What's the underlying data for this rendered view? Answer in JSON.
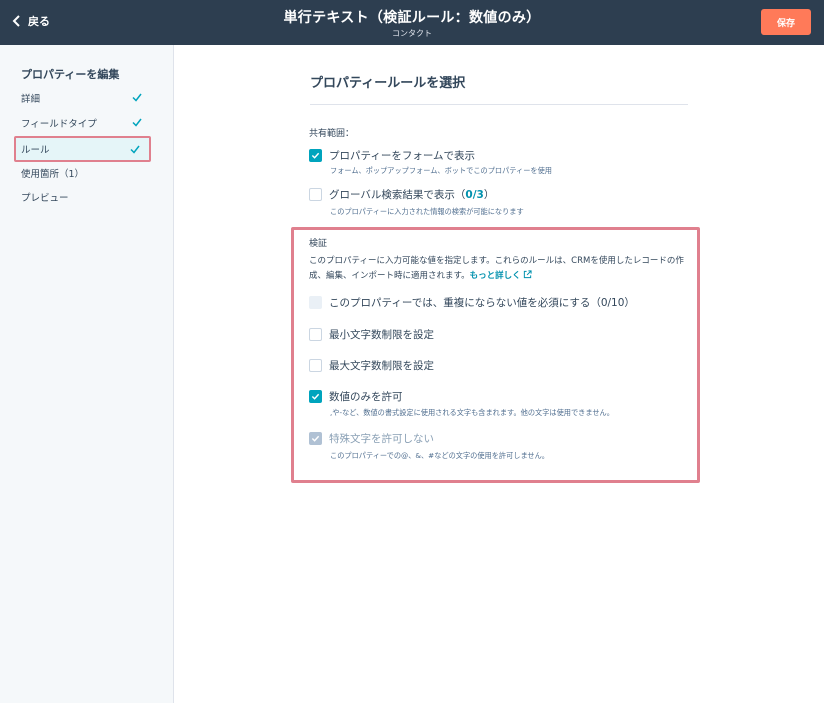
{
  "header": {
    "back_label": "戻る",
    "title": "単行テキスト（検証ルール：数値のみ）",
    "subtitle": "コンタクト",
    "save_label": "保存"
  },
  "sidebar": {
    "title": "プロパティーを編集",
    "items": [
      {
        "label": "詳細",
        "checked": true,
        "active": false
      },
      {
        "label": "フィールドタイプ",
        "checked": true,
        "active": false
      },
      {
        "label": "ルール",
        "checked": true,
        "active": true
      },
      {
        "label": "使用箇所（1）",
        "checked": false,
        "active": false
      },
      {
        "label": "プレビュー",
        "checked": false,
        "active": false
      }
    ]
  },
  "main": {
    "title": "プロパティールールを選択",
    "shared_scope_label": "共有範囲：",
    "show_in_forms": {
      "label": "プロパティーをフォームで表示",
      "help": "フォーム、ポップアップフォーム、ボットでこのプロパティーを使用",
      "checked": true
    },
    "global_search": {
      "label": "グローバル検索結果で表示（",
      "count": "0/3",
      "label_end": "）",
      "help": "このプロパティーに入力された情報の検索が可能になります",
      "checked": false
    },
    "validation": {
      "label": "検証",
      "description": "このプロパティーに入力可能な値を指定します。これらのルールは、CRMを使用したレコードの作成、編集、インポート時に適用されます。",
      "learn_more": "もっと詳しく",
      "unique": {
        "label": "このプロパティーでは、重複にならない値を必須にする（0/10）",
        "state": "disabled"
      },
      "min_chars": {
        "label": "最小文字数制限を設定",
        "state": "unchecked"
      },
      "max_chars": {
        "label": "最大文字数制限を設定",
        "state": "unchecked"
      },
      "numbers_only": {
        "label": "数値のみを許可",
        "help": ",や-など、数値の書式設定に使用される文字も含まれます。他の文字は使用できません。",
        "state": "checked"
      },
      "no_special": {
        "label": "特殊文字を許可しない",
        "help": "このプロパティーでの@、&、#などの文字の使用を許可しません。",
        "state": "checked-disabled"
      }
    }
  },
  "colors": {
    "header_bg": "#2d3e50",
    "accent": "#00a4bd",
    "save_button": "#ff7a59",
    "highlight_border": "#e0808e"
  },
  "icons": [
    "chevron-left-icon",
    "check-icon",
    "external-link-icon"
  ]
}
